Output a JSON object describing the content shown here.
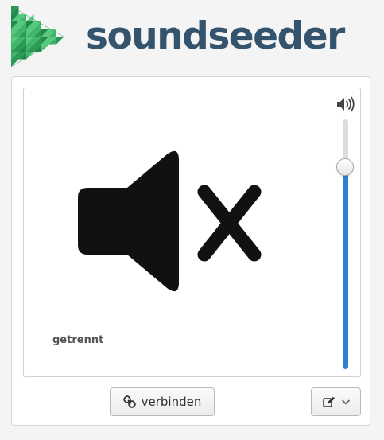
{
  "header": {
    "brand_name": "soundseeder",
    "logo_icon": "triangle-mosaic-logo-icon",
    "brand_color": "#34536d",
    "logo_colors": [
      "#2c9a55",
      "#3fb66a",
      "#57c97d",
      "#238a4b"
    ]
  },
  "player": {
    "status": "getrennt",
    "state_icon": "speaker-muted-icon",
    "volume_icon": "volume-icon",
    "volume_level": 0.81,
    "accent_color": "#2f7ed8"
  },
  "actions": {
    "connect_label": "verbinden",
    "connect_icon": "link-icon",
    "menu_icon": "edit-icon",
    "menu_dropdown_icon": "chevron-down-icon"
  }
}
